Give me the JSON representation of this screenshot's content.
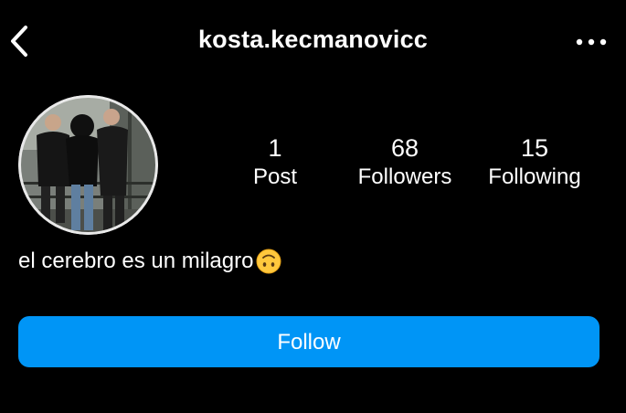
{
  "header": {
    "username": "kosta.kecmanovicc",
    "back_icon": "chevron-left-icon",
    "more_icon": "more-horizontal-icon"
  },
  "profile": {
    "avatar_icon": "profile-photo",
    "stats": [
      {
        "value": "1",
        "label": "Post"
      },
      {
        "value": "68",
        "label": "Followers"
      },
      {
        "value": "15",
        "label": "Following"
      }
    ],
    "bio": "el cerebro es un milagro",
    "bio_emoji": "upside-down-face-emoji"
  },
  "actions": {
    "follow_label": "Follow"
  },
  "colors": {
    "background": "#000000",
    "text": "#ffffff",
    "accent": "#0095f6"
  }
}
